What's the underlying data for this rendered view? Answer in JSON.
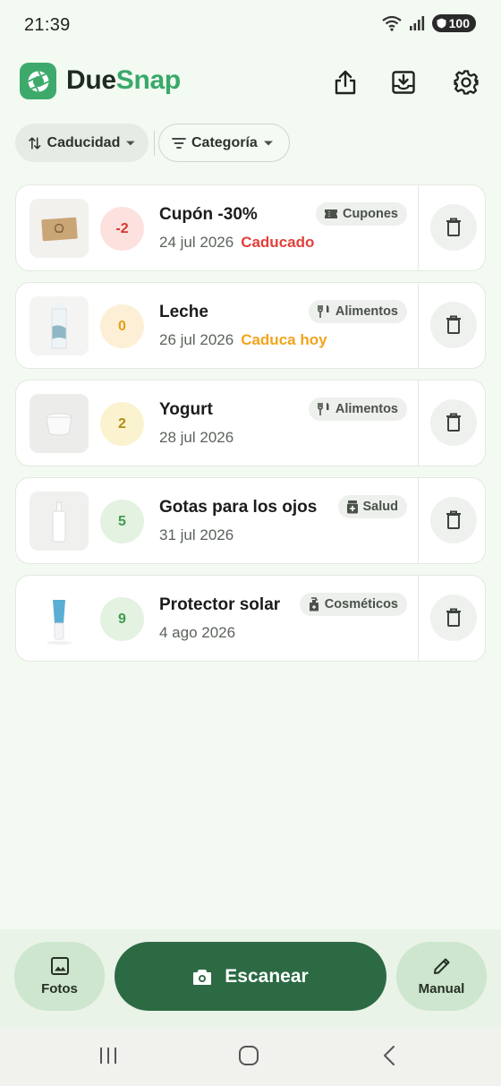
{
  "status_bar": {
    "time": "21:39",
    "battery": "100"
  },
  "header": {
    "title_part1": "Due",
    "title_part2": "Snap",
    "share_icon": "share-icon",
    "download_icon": "download-icon",
    "settings_icon": "gear-icon"
  },
  "filters": {
    "sort_label": "Caducidad",
    "category_label": "Categoría"
  },
  "colors": {
    "accent": "#2c6a44",
    "brand": "#39a96a",
    "expired": "#e0413a",
    "today": "#f2a41c"
  },
  "items": [
    {
      "name": "Cupón -30%",
      "date": "24 jul 2026",
      "status": "Caducado",
      "days": "-2",
      "category": "Cupones",
      "category_icon": "ticket-icon",
      "thumb": "coupon-image"
    },
    {
      "name": "Leche",
      "date": "26 jul 2026",
      "status": "Caduca hoy",
      "days": "0",
      "category": "Alimentos",
      "category_icon": "cutlery-icon",
      "thumb": "milk-carton-image"
    },
    {
      "name": "Yogurt",
      "date": "28 jul 2026",
      "status": "",
      "days": "2",
      "category": "Alimentos",
      "category_icon": "cutlery-icon",
      "thumb": "yogurt-cup-image"
    },
    {
      "name": "Gotas para los ojos",
      "date": "31 jul 2026",
      "status": "",
      "days": "5",
      "category": "Salud",
      "category_icon": "medicine-icon",
      "thumb": "eye-drops-image"
    },
    {
      "name": "Protector solar",
      "date": "4 ago 2026",
      "status": "",
      "days": "9",
      "category": "Cosméticos",
      "category_icon": "lotion-bottle-icon",
      "thumb": "sunscreen-tube-image"
    }
  ],
  "bottom_actions": {
    "photos_label": "Fotos",
    "scan_label": "Escanear",
    "manual_label": "Manual"
  }
}
